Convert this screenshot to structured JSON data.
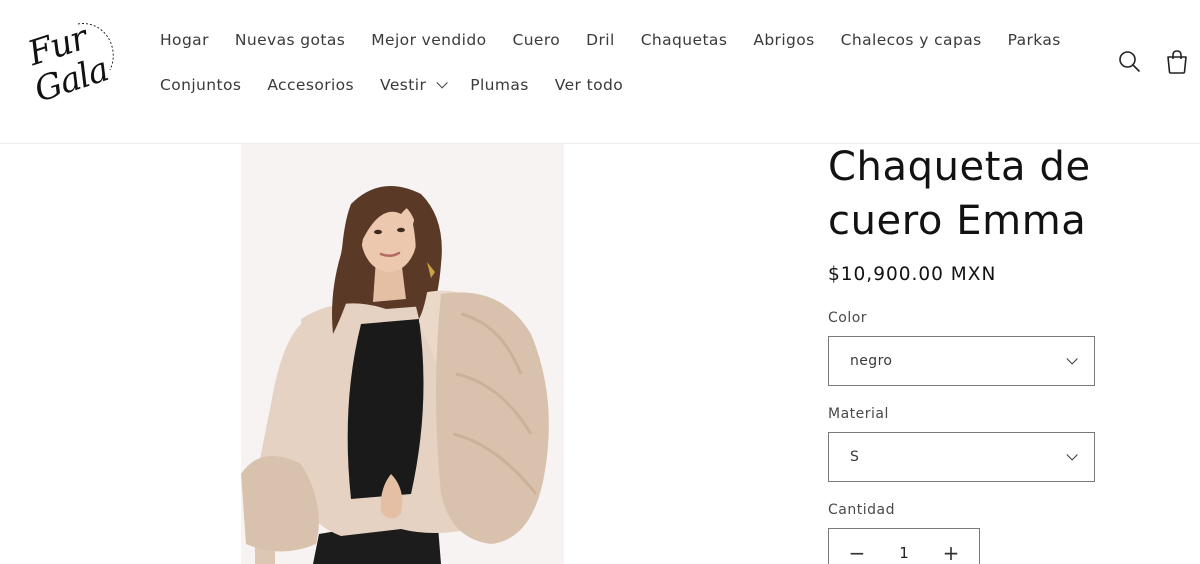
{
  "brand": {
    "logo_line1": "Fur",
    "logo_line2": "Gala",
    "logo_ring_text": "LUXURY FUR BRAND"
  },
  "nav": {
    "row1": [
      "Hogar",
      "Nuevas gotas",
      "Mejor vendido",
      "Cuero",
      "Dril",
      "Chaquetas",
      "Abrigos",
      "Chalecos y capas",
      "Parkas"
    ],
    "row2": [
      "Conjuntos",
      "Accesorios",
      "Vestir",
      "Plumas",
      "Ver todo"
    ],
    "dropdown_item": "Vestir"
  },
  "header_icons": [
    "search-icon",
    "cart-icon"
  ],
  "product": {
    "title": "Chaqueta de cuero Emma",
    "price": "$10,900.00 MXN",
    "color_label": "Color",
    "color_value": "negro",
    "material_label": "Material",
    "material_value": "S",
    "quantity_label": "Cantidad",
    "quantity_value": "1",
    "minus": "−",
    "plus": "+"
  },
  "colors": {
    "text": "#121212",
    "border": "#7a7a7a",
    "photo_bg": "#f7f3f2",
    "jacket": "#e6d2c2",
    "fur": "#d9c2ad"
  }
}
